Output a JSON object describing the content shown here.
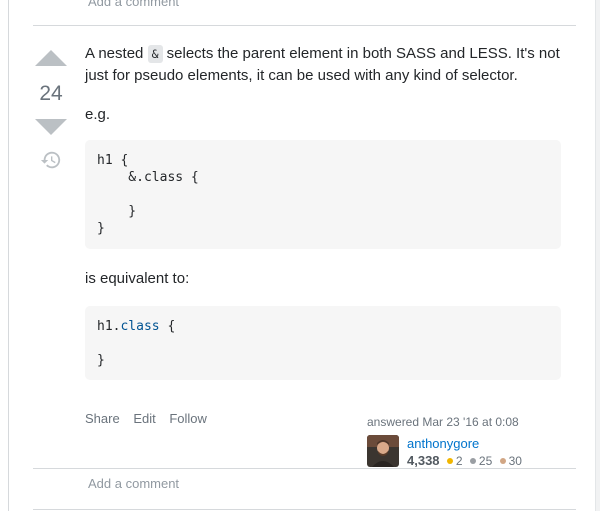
{
  "previous_answer": {
    "add_comment": "Add a comment"
  },
  "answer": {
    "vote_count": "24",
    "intro_before": "A nested ",
    "intro_code": "&",
    "intro_after": " selects the parent element in both SASS and LESS. It's not just for pseudo elements, it can be used with any kind of selector.",
    "eg": "e.g.",
    "code1": "h1 {\n    &.class {\n\n    }\n}",
    "equivalent": "is equivalent to:",
    "code2_selector": "h1.",
    "code2_keyword": "class",
    "code2_rest": " {\n\n}",
    "actions": {
      "share": "Share",
      "edit": "Edit",
      "follow": "Follow"
    },
    "signature": {
      "action": "answered Mar 23 '16 at 0:08",
      "user": "anthonygore",
      "reputation": "4,338",
      "gold": "2",
      "silver": "25",
      "bronze": "30"
    },
    "add_comment": "Add a comment"
  },
  "colors": {
    "gold": "#f1b600",
    "silver": "#9a9ea3",
    "bronze": "#d1a684",
    "link": "#0074cc"
  },
  "icons": {
    "vote_up": "up-triangle-icon",
    "vote_down": "down-triangle-icon",
    "history": "history-icon"
  }
}
